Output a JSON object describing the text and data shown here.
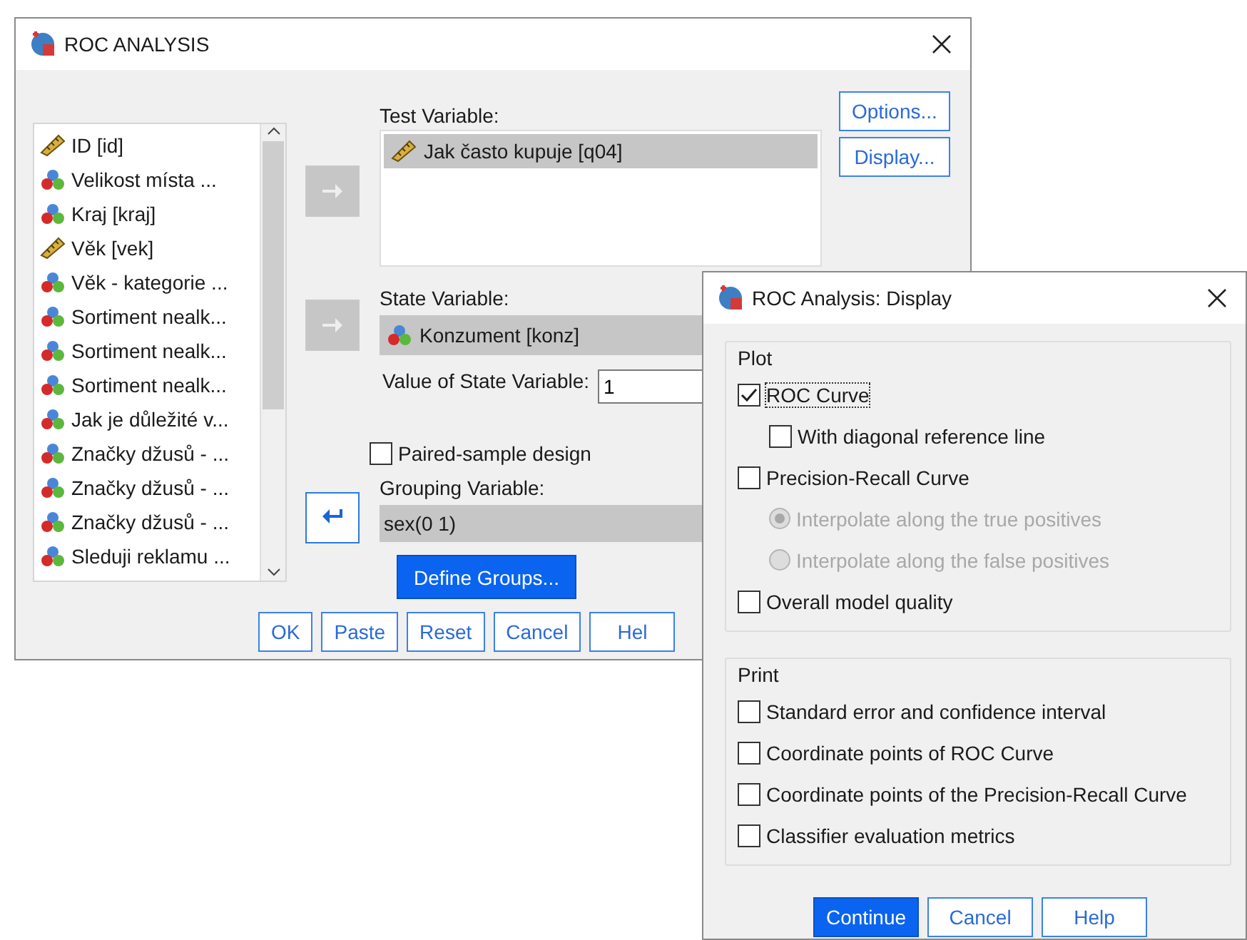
{
  "main_window": {
    "title": "ROC ANALYSIS",
    "variables": [
      {
        "label": "ID [id]",
        "kind": "scale"
      },
      {
        "label": "Velikost místa ...",
        "kind": "nominal"
      },
      {
        "label": "Kraj [kraj]",
        "kind": "nominal"
      },
      {
        "label": "Věk [vek]",
        "kind": "scale"
      },
      {
        "label": "Věk - kategorie ...",
        "kind": "nominal"
      },
      {
        "label": "Sortiment nealk...",
        "kind": "nominal"
      },
      {
        "label": "Sortiment nealk...",
        "kind": "nominal"
      },
      {
        "label": "Sortiment nealk...",
        "kind": "nominal"
      },
      {
        "label": "Jak je důležité v...",
        "kind": "nominal"
      },
      {
        "label": "Značky džusů - ...",
        "kind": "nominal"
      },
      {
        "label": "Značky džusů - ...",
        "kind": "nominal"
      },
      {
        "label": "Značky džusů - ...",
        "kind": "nominal"
      },
      {
        "label": "Sleduji reklamu ...",
        "kind": "nominal"
      }
    ],
    "test_variable": {
      "label": "Test Variable:",
      "value": "Jak často kupuje [q04]",
      "kind": "scale"
    },
    "state_variable": {
      "label": "State Variable:",
      "value": "Konzument [konz]",
      "kind": "nominal"
    },
    "value_of_state": {
      "label": "Value of State Variable:",
      "value": "1"
    },
    "paired": {
      "label": "Paired-sample design",
      "checked": false
    },
    "grouping": {
      "label": "Grouping Variable:",
      "value": "sex(0 1)"
    },
    "define_groups": "Define Groups...",
    "side_buttons": [
      "Options...",
      "Display..."
    ],
    "buttons": [
      "OK",
      "Paste",
      "Reset",
      "Cancel",
      "Hel"
    ]
  },
  "display_window": {
    "title": "ROC Analysis: Display",
    "groups": [
      {
        "title": "Plot",
        "items": [
          {
            "kind": "checkbox",
            "label": "ROC Curve",
            "checked": true,
            "disabled": false,
            "focused": true,
            "children": [
              {
                "kind": "checkbox",
                "label": "With diagonal reference line",
                "checked": false,
                "disabled": false,
                "focused": false
              }
            ]
          },
          {
            "kind": "checkbox",
            "label": "Precision-Recall Curve",
            "checked": false,
            "disabled": false,
            "focused": false,
            "children": [
              {
                "kind": "radio",
                "label": "Interpolate along the true positives",
                "selected": true,
                "disabled": true,
                "focused": false
              },
              {
                "kind": "radio",
                "label": "Interpolate along the false positives",
                "selected": false,
                "disabled": true,
                "focused": false
              }
            ]
          },
          {
            "kind": "checkbox",
            "label": "Overall model quality",
            "checked": false,
            "disabled": false,
            "focused": false
          }
        ]
      },
      {
        "title": "Print",
        "items": [
          {
            "kind": "checkbox",
            "label": "Standard error and confidence interval",
            "checked": false,
            "disabled": false,
            "focused": false
          },
          {
            "kind": "checkbox",
            "label": "Coordinate points of ROC Curve",
            "checked": false,
            "disabled": false,
            "focused": false
          },
          {
            "kind": "checkbox",
            "label": "Coordinate points of the Precision-Recall Curve",
            "checked": false,
            "disabled": false,
            "focused": false
          },
          {
            "kind": "checkbox",
            "label": "Classifier evaluation metrics",
            "checked": false,
            "disabled": false,
            "focused": false
          }
        ]
      }
    ],
    "buttons": [
      {
        "label": "Continue",
        "primary": true
      },
      {
        "label": "Cancel",
        "primary": false
      },
      {
        "label": "Help",
        "primary": false
      }
    ]
  }
}
